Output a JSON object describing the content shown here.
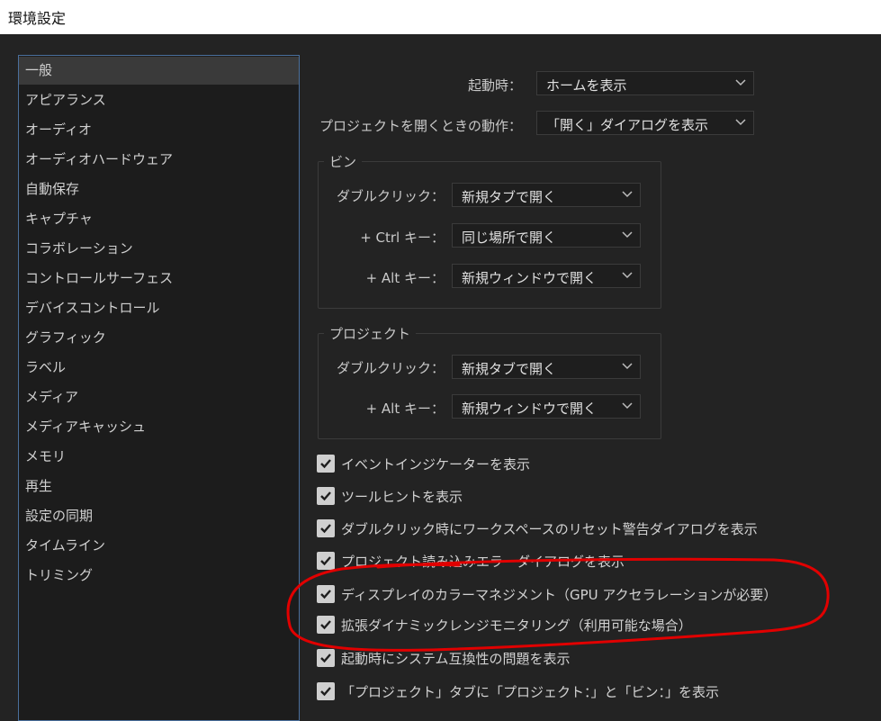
{
  "window": {
    "title": "環境設定"
  },
  "sidebar": {
    "items": [
      {
        "label": "一般",
        "selected": true
      },
      {
        "label": "アピアランス"
      },
      {
        "label": "オーディオ"
      },
      {
        "label": "オーディオハードウェア"
      },
      {
        "label": "自動保存"
      },
      {
        "label": "キャプチャ"
      },
      {
        "label": "コラボレーション"
      },
      {
        "label": "コントロールサーフェス"
      },
      {
        "label": "デバイスコントロール"
      },
      {
        "label": "グラフィック"
      },
      {
        "label": "ラベル"
      },
      {
        "label": "メディア"
      },
      {
        "label": "メディアキャッシュ"
      },
      {
        "label": "メモリ"
      },
      {
        "label": "再生"
      },
      {
        "label": "設定の同期"
      },
      {
        "label": "タイムライン"
      },
      {
        "label": "トリミング"
      }
    ]
  },
  "general": {
    "startup_label": "起動時：",
    "startup_value": "ホームを表示",
    "open_project_label": "プロジェクトを開くときの動作：",
    "open_project_value": "「開く」ダイアログを表示"
  },
  "bin_group": {
    "title": "ビン",
    "double_click_label": "ダブルクリック：",
    "double_click_value": "新規タブで開く",
    "ctrl_label": "+ Ctrl キー：",
    "ctrl_value": "同じ場所で開く",
    "alt_label": "+ Alt キー：",
    "alt_value": "新規ウィンドウで開く"
  },
  "project_group": {
    "title": "プロジェクト",
    "double_click_label": "ダブルクリック：",
    "double_click_value": "新規タブで開く",
    "alt_label": "+ Alt キー：",
    "alt_value": "新規ウィンドウで開く"
  },
  "checkboxes": [
    {
      "label": "イベントインジケーターを表示",
      "checked": true
    },
    {
      "label": "ツールヒントを表示",
      "checked": true
    },
    {
      "label": "ダブルクリック時にワークスペースのリセット警告ダイアログを表示",
      "checked": true
    },
    {
      "label": "プロジェクト読み込みエラーダイアログを表示",
      "checked": true
    },
    {
      "label": "ディスプレイのカラーマネジメント（GPU アクセラレーションが必要）",
      "checked": true
    },
    {
      "label": " 拡張ダイナミックレンジモニタリング（利用可能な場合）",
      "checked": true
    },
    {
      "label": "起動時にシステム互換性の問題を表示",
      "checked": true
    },
    {
      "label": "「プロジェクト」タブに「プロジェクト：」と「ビン：」を表示",
      "checked": true
    }
  ],
  "annotation": {
    "color": "#e10000"
  },
  "colors": {
    "background": "#232323",
    "sidebar": "#1c1c1c",
    "selection": "#3a3a3a",
    "focus_border": "#4a6f9c"
  }
}
